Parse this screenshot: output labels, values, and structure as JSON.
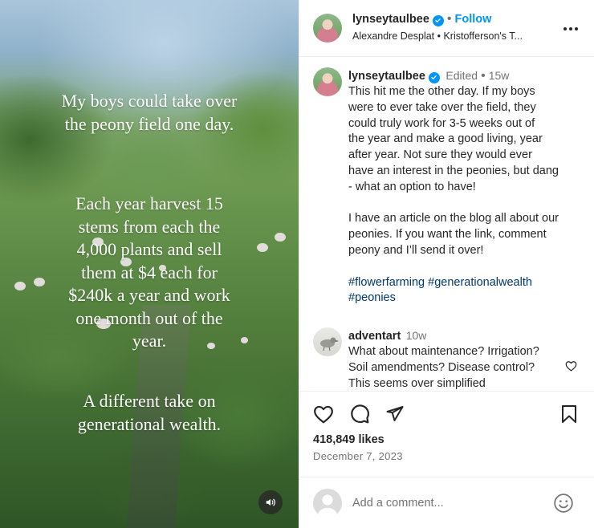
{
  "media": {
    "overlay_text_1_line_1": "My boys could take over",
    "overlay_text_1_line_2": "the peony field one day.",
    "overlay_text_2_lines": [
      "Each year harvest 15",
      "stems from each the",
      "4,000 plants and sell",
      "them at $4 each for",
      "$240k a year and work",
      "one month out of the",
      "year."
    ],
    "overlay_text_3_line_1": "A different take on",
    "overlay_text_3_line_2": "generational wealth.",
    "sound_icon": "speaker-icon"
  },
  "header": {
    "username": "lynseytaulbee",
    "separator": "•",
    "follow_label": "Follow",
    "audio_text": "Alexandre Desplat • Kristofferson's T..."
  },
  "caption": {
    "username": "lynseytaulbee",
    "edited_label": "Edited",
    "separator": "•",
    "time": "15w",
    "text_lines": [
      "This hit me the other day. If my boys",
      "were to ever take over the field, they",
      "could truly work for 3-5 weeks out of",
      "the year and make a good living, year",
      "after year. Not sure they would ever",
      "have an interest in the peonies, but dang",
      "- what an option to have!"
    ],
    "text_lines_2": [
      "I have an article on the blog all about our",
      "peonies. If you want the link, comment",
      "peony and I’ll send it over!"
    ],
    "hashtag_1": "#flowerfarming",
    "hashtag_2": "#generationalwealth",
    "hashtag_3": "#peonies"
  },
  "comment": {
    "username": "adventart",
    "time": "10w",
    "text_lines": [
      "What about maintenance? Irrigation?",
      "Soil amendments? Disease control?",
      "This seems over simplified"
    ]
  },
  "actions": {
    "likes": "418,849 likes",
    "date": "December 7, 2023"
  },
  "add_comment": {
    "placeholder": "Add a comment..."
  },
  "colors": {
    "accent": "#0095f6",
    "hashtag": "#00376b",
    "muted": "#737373",
    "text": "#262626"
  }
}
